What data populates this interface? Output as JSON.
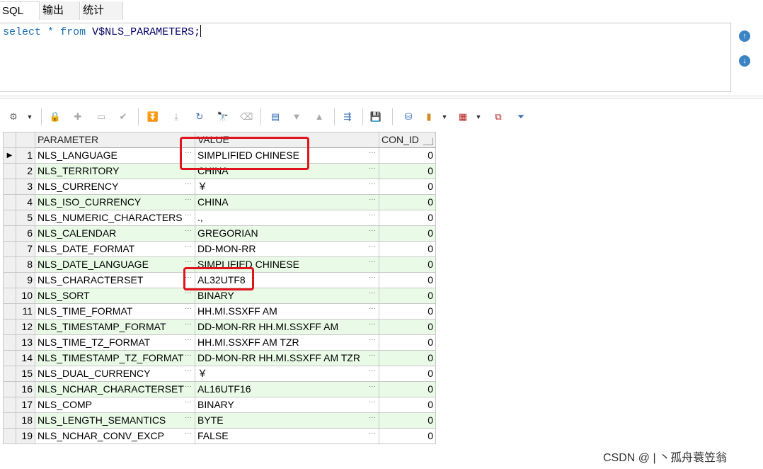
{
  "tabs": [
    "SQL",
    "输出",
    "统计"
  ],
  "editor": {
    "keyword_select": "select",
    "star": "*",
    "keyword_from": "from",
    "table": "V$NLS_PARAMETERS;"
  },
  "grid": {
    "headers": [
      "PARAMETER",
      "VALUE",
      "CON_ID"
    ],
    "rows": [
      {
        "n": "1",
        "parameter": "NLS_LANGUAGE",
        "value": "SIMPLIFIED CHINESE",
        "con_id": "0"
      },
      {
        "n": "2",
        "parameter": "NLS_TERRITORY",
        "value": "CHINA",
        "con_id": "0"
      },
      {
        "n": "3",
        "parameter": "NLS_CURRENCY",
        "value": "￥",
        "con_id": "0"
      },
      {
        "n": "4",
        "parameter": "NLS_ISO_CURRENCY",
        "value": "CHINA",
        "con_id": "0"
      },
      {
        "n": "5",
        "parameter": "NLS_NUMERIC_CHARACTERS",
        "value": ".,",
        "con_id": "0"
      },
      {
        "n": "6",
        "parameter": "NLS_CALENDAR",
        "value": "GREGORIAN",
        "con_id": "0"
      },
      {
        "n": "7",
        "parameter": "NLS_DATE_FORMAT",
        "value": "DD-MON-RR",
        "con_id": "0"
      },
      {
        "n": "8",
        "parameter": "NLS_DATE_LANGUAGE",
        "value": "SIMPLIFIED CHINESE",
        "con_id": "0"
      },
      {
        "n": "9",
        "parameter": "NLS_CHARACTERSET",
        "value": "AL32UTF8",
        "con_id": "0"
      },
      {
        "n": "10",
        "parameter": "NLS_SORT",
        "value": "BINARY",
        "con_id": "0"
      },
      {
        "n": "11",
        "parameter": "NLS_TIME_FORMAT",
        "value": "HH.MI.SSXFF AM",
        "con_id": "0"
      },
      {
        "n": "12",
        "parameter": "NLS_TIMESTAMP_FORMAT",
        "value": "DD-MON-RR HH.MI.SSXFF AM",
        "con_id": "0"
      },
      {
        "n": "13",
        "parameter": "NLS_TIME_TZ_FORMAT",
        "value": "HH.MI.SSXFF AM TZR",
        "con_id": "0"
      },
      {
        "n": "14",
        "parameter": "NLS_TIMESTAMP_TZ_FORMAT",
        "value": "DD-MON-RR HH.MI.SSXFF AM TZR",
        "con_id": "0"
      },
      {
        "n": "15",
        "parameter": "NLS_DUAL_CURRENCY",
        "value": "￥",
        "con_id": "0"
      },
      {
        "n": "16",
        "parameter": "NLS_NCHAR_CHARACTERSET",
        "value": "AL16UTF16",
        "con_id": "0"
      },
      {
        "n": "17",
        "parameter": "NLS_COMP",
        "value": "BINARY",
        "con_id": "0"
      },
      {
        "n": "18",
        "parameter": "NLS_LENGTH_SEMANTICS",
        "value": "BYTE",
        "con_id": "0"
      },
      {
        "n": "19",
        "parameter": "NLS_NCHAR_CONV_EXCP",
        "value": "FALSE",
        "con_id": "0"
      }
    ]
  },
  "watermark": "CSDN @ | 丶孤舟蓑笠翁",
  "colors": {
    "alt_row": "#e9fbe7",
    "highlight": "#e0141c",
    "keyword": "#1d6fb3"
  }
}
